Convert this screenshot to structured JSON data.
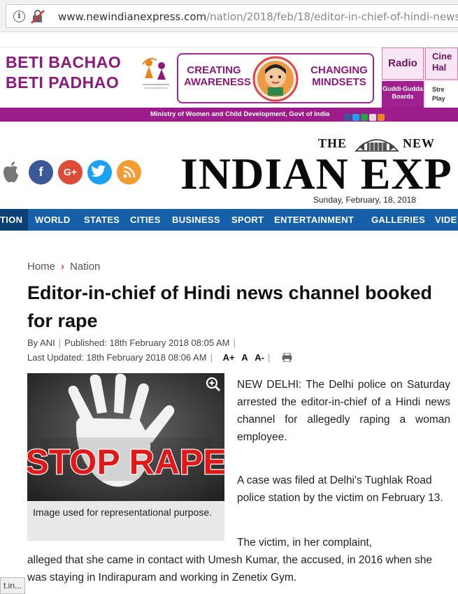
{
  "browser": {
    "url_domain": "www.newindianexpress.com",
    "url_path": "/nation/2018/feb/18/editor-in-chief-of-hindi-news"
  },
  "banner": {
    "line1": "BETI BACHAO",
    "line2": "BETI PADHAO",
    "left_word1": "CREATING",
    "left_word2": "AWARENESS",
    "right_word1": "CHANGING",
    "right_word2": "MINDSETS",
    "radio": "Radio",
    "guddi": "Guddi-Gudda Boards",
    "cine1": "Cine",
    "cine2": "Hal",
    "street1": "Stre",
    "street2": "Play",
    "ministry": "Ministry of Women and Child Development, Govt of India"
  },
  "masthead": {
    "the": "THE",
    "new": "NEW",
    "main": "INDIAN EXP",
    "date": "Sunday, February, 18, 2018"
  },
  "social": {
    "facebook": "f",
    "googleplus": "G+"
  },
  "nav": [
    "TION",
    "WORLD",
    "STATES",
    "CITIES",
    "BUSINESS",
    "SPORT",
    "ENTERTAINMENT",
    "GALLERIES",
    "VIDE"
  ],
  "breadcrumb": {
    "home": "Home",
    "sep": "›",
    "section": "Nation"
  },
  "article": {
    "headline": "Editor-in-chief of Hindi news channel booked for rape",
    "byline": "By ANI",
    "published": "Published: 18th February 2018 08:05 AM",
    "updated": "Last Updated: 18th February 2018 08:06 AM",
    "font_larger": "A+",
    "font_normal": "A",
    "font_smaller": "A-",
    "photo_text": "STOP RAPE",
    "caption": "Image used for representational purpose.",
    "dateline": "NEW DELHI:",
    "para1_rest": "The Delhi police on Saturday arrested the editor-in-chief of a Hindi news channel for allegedly raping a woman employee.",
    "para2": "A case was filed at Delhi's Tughlak Road police station by the victim on February 13.",
    "para3_start": "The victim, in her complaint,",
    "para3_rest": "alleged that she came in contact with Umesh Kumar, the accused, in 2016 when she was staying in Indirapuram and working in Zenetix Gym."
  },
  "status_bar": "t.in...",
  "colors": {
    "nav_blue": "#1560a8",
    "banner_purple": "#9b1c8a",
    "facebook": "#3b5998",
    "googleplus": "#dd4b39",
    "twitter": "#1da1f2",
    "rss": "#f39c33"
  }
}
